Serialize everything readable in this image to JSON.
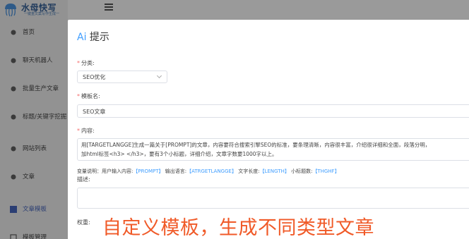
{
  "logo": {
    "title": "水母快写",
    "subtitle": "一键重文案写作生成一"
  },
  "sidebar": {
    "items": [
      {
        "label": "首页",
        "icon": "home-icon"
      },
      {
        "label": "聊天机器人",
        "icon": "chat-icon"
      },
      {
        "label": "批量生产文章",
        "icon": "batch-icon"
      },
      {
        "label": "标题/关键字挖掘",
        "icon": "keyword-icon"
      },
      {
        "label": "网站列表",
        "icon": "website-icon"
      },
      {
        "label": "文章",
        "icon": "article-icon"
      },
      {
        "label": "文章模板",
        "icon": "template-icon"
      },
      {
        "label": "模板管理",
        "icon": "template-manage-icon"
      }
    ]
  },
  "dialog": {
    "title_prefix": "Ai",
    "title": "提示",
    "category_label": "分类:",
    "category_value": "SEO优化",
    "template_name_label": "模板名:",
    "template_name_value": "SEO文章",
    "content_label": "内容:",
    "content_line1": "用[TARGETLANGGE]生成一篇关于[PROMPT]的文章，内容要符合搜索引擎SEO的标准，要条理清晰，内容很丰富，介绍很详细和全面，段落分明，",
    "content_line2": "加html标签<h3> </h3>，要有3个小标题，详细介绍，文章字数要1000字以上。",
    "vars_prefix": "变量说明：用户输入内容:",
    "var_prompt": "【PROMPT】",
    "vars_mid1": "输出语言:",
    "var_lang": "【ATRGETLANGGE】",
    "vars_mid2": "文字长度:",
    "var_length": "【LENGTH】",
    "vars_mid3": "小标题数:",
    "var_headings": "【THGHF】",
    "description_label": "描述:",
    "weight_label": "权重:"
  },
  "caption": "自定义模板，生成不同类型文章",
  "colors": {
    "accent": "#409eff",
    "required": "#f56c6c",
    "caption": "#f05a28",
    "active_nav": "#2b3e73"
  }
}
